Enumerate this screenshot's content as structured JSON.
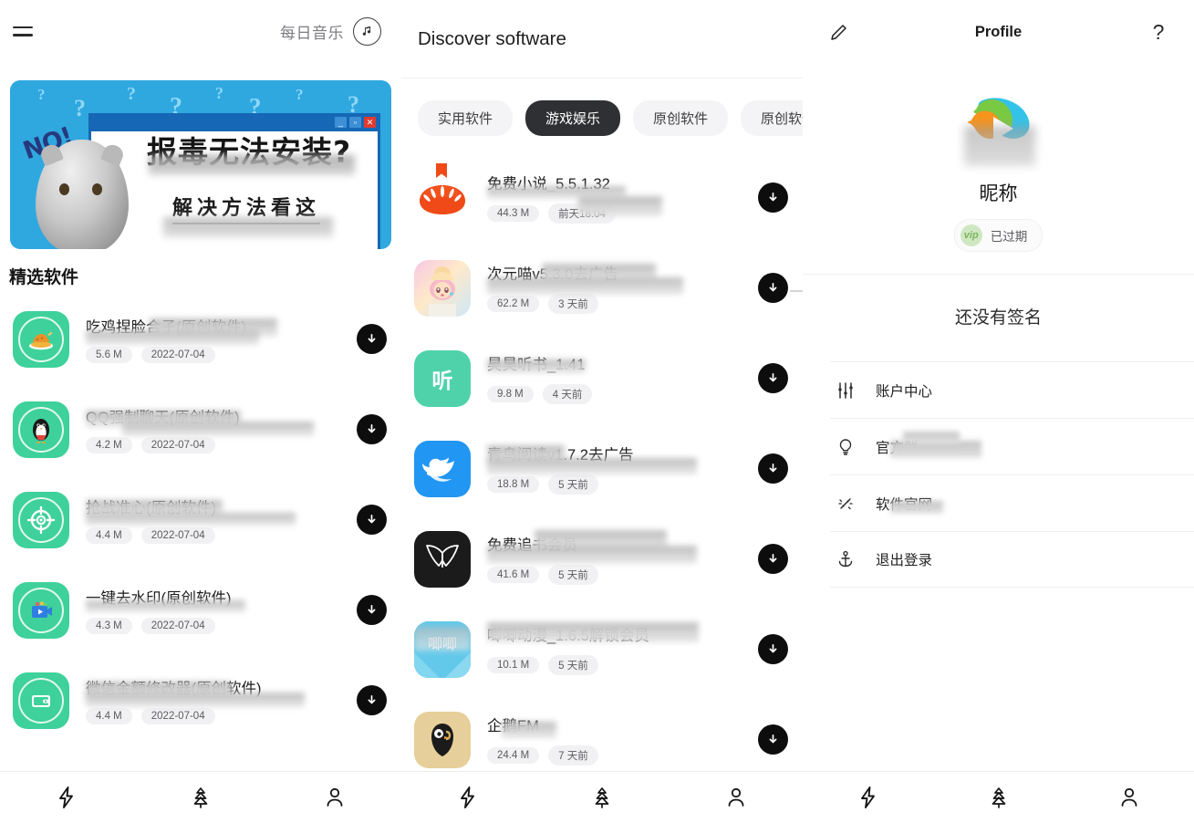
{
  "left": {
    "topbar": {
      "menu_icon": "hamburger-icon",
      "daily_music_label": "每日音乐",
      "music_icon": "music-note-icon"
    },
    "banner": {
      "headline": "报毒无法安装?",
      "subline": "解决方法看这",
      "no_text": "NO!",
      "question_marks": "?"
    },
    "section_title": "精选软件",
    "apps": [
      {
        "name": "吃鸡捏脸合子(原创软件)",
        "size": "5.6 M",
        "date": "2022-07-04",
        "icon": "roast-chicken-icon"
      },
      {
        "name": "QQ强制聊天(原创软件)",
        "size": "4.2 M",
        "date": "2022-07-04",
        "icon": "penguin-icon"
      },
      {
        "name": "抢战准心(原创软件)",
        "size": "4.4 M",
        "date": "2022-07-04",
        "icon": "crosshair-icon"
      },
      {
        "name": "一键去水印(原创软件)",
        "size": "4.3 M",
        "date": "2022-07-04",
        "icon": "video-play-icon"
      },
      {
        "name": "微信金额修改器(原创软件)",
        "size": "4.4 M",
        "date": "2022-07-04",
        "icon": "wallet-icon"
      }
    ]
  },
  "middle": {
    "title": "Discover software",
    "tabs": [
      {
        "label": "实用软件",
        "active": false
      },
      {
        "label": "游戏娱乐",
        "active": true
      },
      {
        "label": "原创软件",
        "active": false
      },
      {
        "label": "原创软件",
        "active": false
      }
    ],
    "apps": [
      {
        "name": "免费小说_5.5.1.32",
        "size": "44.3 M",
        "date": "前天18:04",
        "icon": "tomato-icon",
        "badge": "bookmark-flag"
      },
      {
        "name": "次元喵v5.3.0去广告",
        "size": "62.2 M",
        "date": "3 天前",
        "icon": "anime-girl-icon"
      },
      {
        "name": "昊昊听书_1.41",
        "size": "9.8 M",
        "date": "4 天前",
        "icon": "listen-icon"
      },
      {
        "name": "青鸟阅读v1.7.2去广告",
        "size": "18.8 M",
        "date": "5 天前",
        "icon": "bluebird-icon"
      },
      {
        "name": "免费追书会员",
        "size": "41.6 M",
        "date": "5 天前",
        "icon": "open-book-icon"
      },
      {
        "name": "唧唧动漫_1.6.5解锁会员",
        "size": "10.1 M",
        "date": "5 天前",
        "icon": "anime-card-icon"
      },
      {
        "name": "企鹅FM",
        "size": "24.4 M",
        "date": "7 天前",
        "icon": "penguin-fm-icon"
      }
    ]
  },
  "right": {
    "header": {
      "edit_icon": "pencil-icon",
      "title": "Profile",
      "help_label": "?"
    },
    "avatar_icon": "tencent-video-logo",
    "nickname": "昵称",
    "vip": {
      "badge": "vip",
      "status": "已过期"
    },
    "signature": "还没有签名",
    "menu": [
      {
        "label": "账户中心",
        "icon": "sliders-icon"
      },
      {
        "label": "官方群",
        "icon": "lightbulb-icon"
      },
      {
        "label": "软件官网",
        "icon": "sparkle-icon"
      },
      {
        "label": "退出登录",
        "icon": "anchor-icon"
      }
    ]
  },
  "bottom_nav": [
    {
      "icon": "lightning-icon",
      "name": "flash"
    },
    {
      "icon": "pine-tree-icon",
      "name": "discover"
    },
    {
      "icon": "person-icon",
      "name": "profile"
    }
  ],
  "colors": {
    "accent_green": "#3ed19b",
    "banner_blue": "#2fa8e0",
    "dark": "#0d0d0d",
    "tab_active_bg": "#2f3033",
    "vip_green": "#7ab55c"
  }
}
